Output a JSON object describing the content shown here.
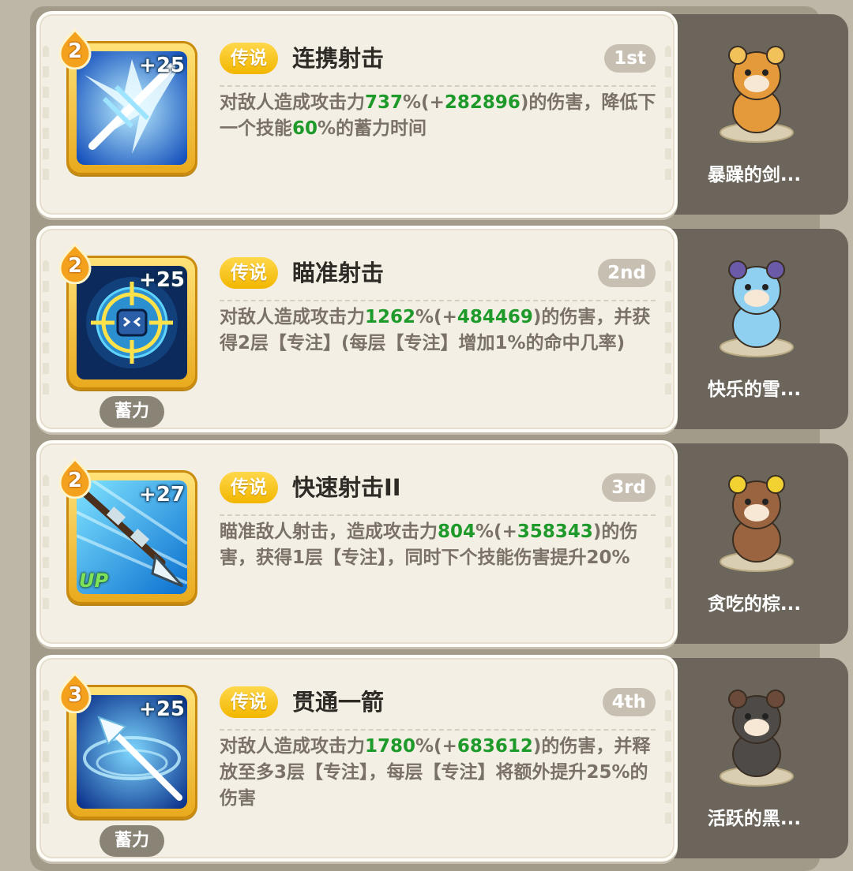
{
  "skills": [
    {
      "level": "2",
      "plus": "+25",
      "up": "",
      "charge": "",
      "rarity": "传说",
      "name": "连携射击",
      "rank": "1st",
      "desc": [
        {
          "t": "对敌人造成攻击力"
        },
        {
          "t": "737",
          "g": true
        },
        {
          "t": "%(+"
        },
        {
          "t": "282896",
          "g": true
        },
        {
          "t": ")的伤害，降低下一个技能"
        },
        {
          "t": "60",
          "g": true
        },
        {
          "t": "%的蓄力时间"
        }
      ],
      "pet": "暴躁的剑...",
      "icon": "ice-blade-icon",
      "pet_icon": "raccoon-pet-icon"
    },
    {
      "level": "2",
      "plus": "+25",
      "up": "",
      "charge": "蓄力",
      "rarity": "传说",
      "name": "瞄准射击",
      "rank": "2nd",
      "desc": [
        {
          "t": "对敌人造成攻击力"
        },
        {
          "t": "1262",
          "g": true
        },
        {
          "t": "%(+"
        },
        {
          "t": "484469",
          "g": true
        },
        {
          "t": ")的伤害，并获得2层【专注】(每层【专注】增加1%的命中几率)"
        }
      ],
      "pet": "快乐的雪...",
      "icon": "crosshair-target-icon",
      "pet_icon": "snow-bunny-pet-icon"
    },
    {
      "level": "2",
      "plus": "+27",
      "up": "UP",
      "charge": "",
      "rarity": "传说",
      "name": "快速射击II",
      "rank": "3rd",
      "desc": [
        {
          "t": "瞄准敌人射击，造成攻击力"
        },
        {
          "t": "804",
          "g": true
        },
        {
          "t": "%(+"
        },
        {
          "t": "358343",
          "g": true
        },
        {
          "t": ")的伤害，获得1层【专注】，同时下个技能伤害提升20%"
        }
      ],
      "pet": "贪吃的棕...",
      "icon": "arrow-shot-icon",
      "pet_icon": "bee-bear-pet-icon"
    },
    {
      "level": "3",
      "plus": "+25",
      "up": "",
      "charge": "蓄力",
      "rarity": "传说",
      "name": "贯通一箭",
      "rank": "4th",
      "desc": [
        {
          "t": "对敌人造成攻击力"
        },
        {
          "t": "1780",
          "g": true
        },
        {
          "t": "%(+"
        },
        {
          "t": "683612",
          "g": true
        },
        {
          "t": ")的伤害，并释放至多3层【专注】，每层【专注】将额外提升25%的伤害"
        }
      ],
      "pet": "活跃的黑...",
      "icon": "piercing-arrow-icon",
      "pet_icon": "black-pig-pet-icon"
    }
  ],
  "colors": {
    "highlight": "#1d9a2a",
    "rarity_legend": "#f2b600",
    "pet_panel": "#6b655b",
    "card_bg": "#f4efe4"
  }
}
